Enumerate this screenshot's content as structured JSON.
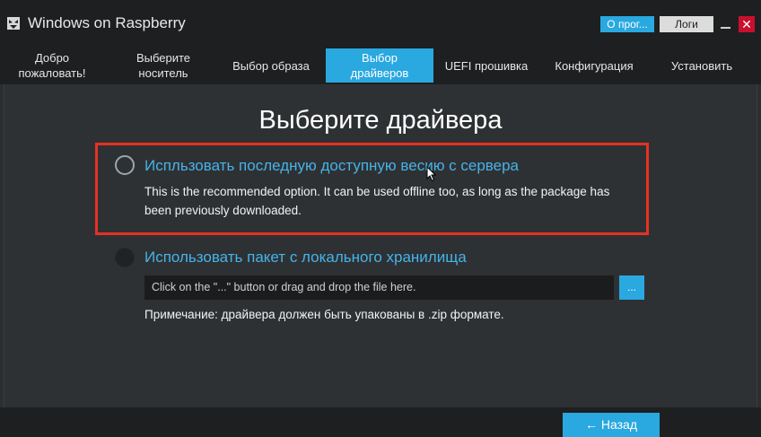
{
  "window": {
    "title": "Windows on Raspberry",
    "about_label": "О прог...",
    "logs_label": "Логи",
    "close_glyph": "✕"
  },
  "tabs": [
    {
      "line1": "Добро",
      "line2": "пожаловать!",
      "active": false
    },
    {
      "line1": "Выберите",
      "line2": "носитель",
      "active": false
    },
    {
      "line1": "Выбор образа",
      "line2": "",
      "active": false
    },
    {
      "line1": "Выбор",
      "line2": "драйверов",
      "active": true
    },
    {
      "line1": "UEFI прошивка",
      "line2": "",
      "active": false
    },
    {
      "line1": "Конфигурация",
      "line2": "",
      "active": false
    },
    {
      "line1": "Установить",
      "line2": "",
      "active": false
    }
  ],
  "page": {
    "title": "Выберите драйвера",
    "option_online": {
      "label": "Испльзовать последную доступную весию с сервера",
      "description": "This is the recommended option. It can be used offline too, as long as the package has been previously downloaded.",
      "selected": false
    },
    "option_local": {
      "label": "Использовать пакет с локального хранилища",
      "file_placeholder": "Click on the \"...\" button or drag and drop the file here.",
      "browse_label": "...",
      "note": "Примечание: драйвера должен быть упакованы в .zip формате.",
      "selected": false
    }
  },
  "footer": {
    "back_label": "← Назад"
  },
  "colors": {
    "accent": "#2aa8e0",
    "link_text": "#45b3ea",
    "highlight": "#e53223",
    "close": "#c8102e",
    "background": "#2e3133",
    "bar": "#1e1f20"
  }
}
